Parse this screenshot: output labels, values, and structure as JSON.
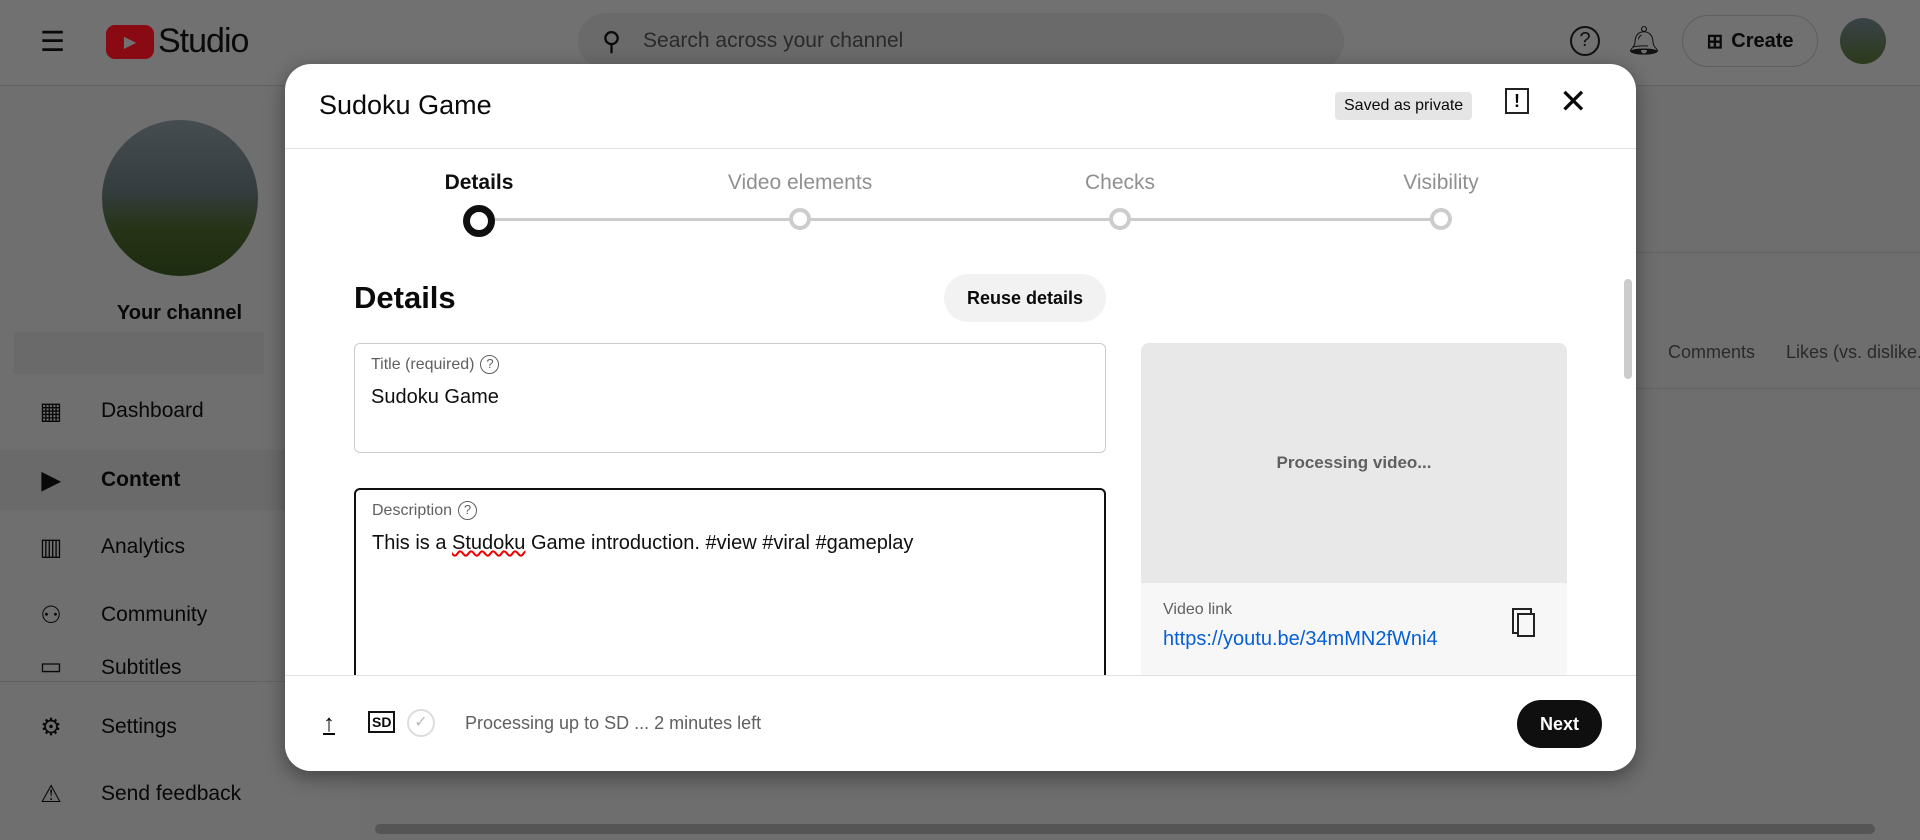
{
  "header": {
    "logo_text": "Studio",
    "search_placeholder": "Search across your channel",
    "create_label": "Create"
  },
  "sidebar": {
    "channel_label": "Your channel",
    "items": [
      {
        "label": "Dashboard",
        "icon": "dashboard-icon"
      },
      {
        "label": "Content",
        "icon": "content-icon"
      },
      {
        "label": "Analytics",
        "icon": "analytics-icon"
      },
      {
        "label": "Community",
        "icon": "community-icon"
      },
      {
        "label": "Subtitles",
        "icon": "subtitles-icon"
      }
    ],
    "bottom": [
      {
        "label": "Settings",
        "icon": "gear-icon"
      },
      {
        "label": "Send feedback",
        "icon": "feedback-icon"
      }
    ]
  },
  "background_table": {
    "columns": [
      "Comments",
      "Likes (vs. dislike..."
    ]
  },
  "modal": {
    "title": "Sudoku Game",
    "saved_badge": "Saved as private",
    "steps": [
      {
        "label": "Details",
        "active": true
      },
      {
        "label": "Video elements",
        "active": false
      },
      {
        "label": "Checks",
        "active": false
      },
      {
        "label": "Visibility",
        "active": false
      }
    ],
    "section_title": "Details",
    "reuse_label": "Reuse details",
    "title_field": {
      "label": "Title (required)",
      "value": "Sudoku Game"
    },
    "description_field": {
      "label": "Description",
      "value_pre": "This is a ",
      "value_misspelled": "Studoku",
      "value_post": " Game introduction. #view #viral #gameplay"
    },
    "preview": {
      "status": "Processing video...",
      "link_label": "Video link",
      "link": "https://youtu.be/34mMN2fWni4"
    },
    "footer": {
      "sd_badge": "SD",
      "status": "Processing up to SD ... 2 minutes left",
      "next_label": "Next"
    }
  }
}
